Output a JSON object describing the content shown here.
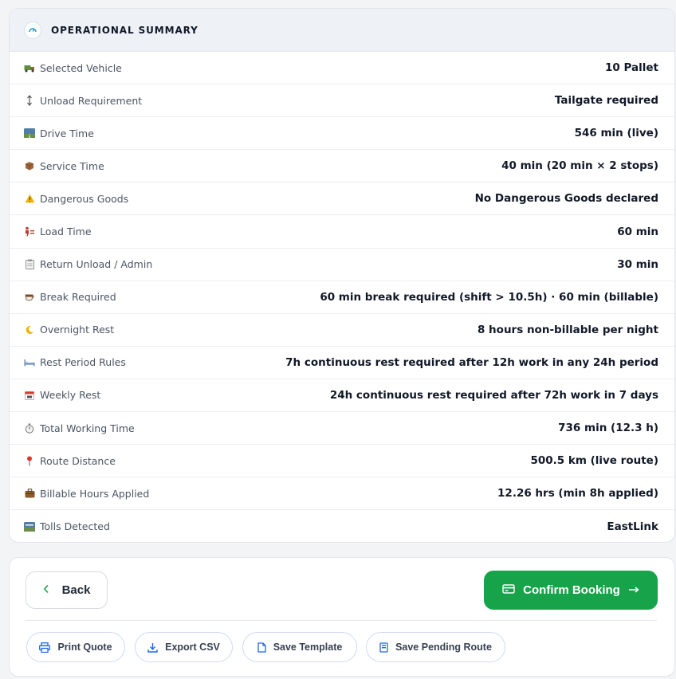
{
  "summary": {
    "title": "OPERATIONAL SUMMARY",
    "rows": [
      {
        "icon": "truck-icon",
        "label": "Selected Vehicle",
        "value": "10 Pallet"
      },
      {
        "icon": "up-down-arrow-icon",
        "label": "Unload Requirement",
        "value": "Tailgate required"
      },
      {
        "icon": "road-icon",
        "label": "Drive Time",
        "value": "546 min (live)"
      },
      {
        "icon": "package-icon",
        "label": "Service Time",
        "value": "40 min (20 min × 2 stops)"
      },
      {
        "icon": "warning-icon",
        "label": "Dangerous Goods",
        "value": "No Dangerous Goods declared"
      },
      {
        "icon": "loading-icon",
        "label": "Load Time",
        "value": "60 min"
      },
      {
        "icon": "clipboard-icon",
        "label": "Return Unload / Admin",
        "value": "30 min"
      },
      {
        "icon": "coffee-icon",
        "label": "Break Required",
        "value": "60 min break required (shift > 10.5h) · 60 min (billable)"
      },
      {
        "icon": "moon-icon",
        "label": "Overnight Rest",
        "value": "8 hours non-billable per night"
      },
      {
        "icon": "bed-icon",
        "label": "Rest Period Rules",
        "value": "7h continuous rest required after 12h work in any 24h period"
      },
      {
        "icon": "calendar-icon",
        "label": "Weekly Rest",
        "value": "24h continuous rest required after 72h work in 7 days"
      },
      {
        "icon": "stopwatch-icon",
        "label": "Total Working Time",
        "value": "736 min (12.3 h)"
      },
      {
        "icon": "pin-icon",
        "label": "Route Distance",
        "value": "500.5 km (live route)"
      },
      {
        "icon": "briefcase-icon",
        "label": "Billable Hours Applied",
        "value": "12.26 hrs (min 8h applied)"
      },
      {
        "icon": "toll-icon",
        "label": "Tolls Detected",
        "value": "EastLink"
      }
    ]
  },
  "actions": {
    "back_label": "Back",
    "confirm_label": "Confirm Booking",
    "print_label": "Print Quote",
    "export_label": "Export CSV",
    "save_template_label": "Save Template",
    "save_pending_label": "Save Pending Route"
  },
  "colors": {
    "primary_green": "#16a34a",
    "header_bg": "#eef2f7",
    "pill_icon_blue": "#2563eb"
  }
}
